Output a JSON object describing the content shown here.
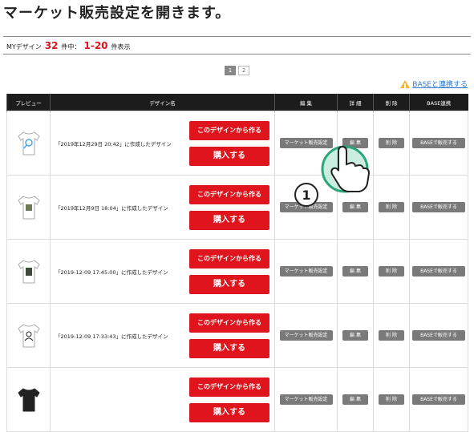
{
  "heading": "マーケット販売設定を開きます。",
  "count": {
    "prefix": "MYデザイン",
    "total": "32",
    "middle": "件中：",
    "range": "1-20",
    "suffix": "件表示"
  },
  "pagination": [
    "1",
    "2"
  ],
  "base_link": "BASEと連携する",
  "columns": [
    "プレビュー",
    "デザイン名",
    "編 集",
    "詳 細",
    "削 除",
    "BASE連携"
  ],
  "rows": [
    {
      "name": "「2019年12月29日 20:42」に作成したデザイン"
    },
    {
      "name": "「2019年12月9日 18:04」に作成したデザイン"
    },
    {
      "name": "「2019-12-09 17:45:00」に作成したデザイン"
    },
    {
      "name": "「2019-12-09 17:33:43」に作成したデザイン"
    },
    {
      "name": ""
    }
  ],
  "buttons": {
    "create": "このデザインから作る",
    "buy": "購入する",
    "market": "マーケット販売設定",
    "detail": "編 集",
    "delete": "削 除",
    "base": "BASEで販売する"
  },
  "step_badge": "1",
  "colors": {
    "accent": "#e0141d",
    "header": "#1c1c1c",
    "button_gray": "#7a7a7a",
    "link": "#2a7ad9"
  }
}
